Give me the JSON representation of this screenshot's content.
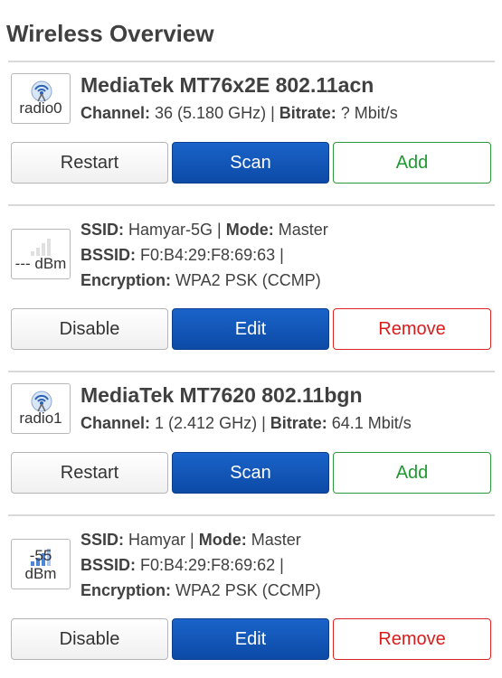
{
  "page": {
    "title": "Wireless Overview"
  },
  "devices": [
    {
      "radio_label": "radio0",
      "title": "MediaTek MT76x2E 802.11acn",
      "channel_label": "Channel:",
      "channel_value": " 36 (5.180 GHz) | ",
      "bitrate_label": "Bitrate:",
      "bitrate_value": " ? Mbit/s",
      "buttons": {
        "restart": "Restart",
        "scan": "Scan",
        "add": "Add"
      }
    },
    {
      "radio_label": "radio1",
      "title": "MediaTek MT7620 802.11bgn",
      "channel_label": "Channel:",
      "channel_value": " 1 (2.412 GHz) | ",
      "bitrate_label": "Bitrate:",
      "bitrate_value": " 64.1 Mbit/s",
      "buttons": {
        "restart": "Restart",
        "scan": "Scan",
        "add": "Add"
      }
    }
  ],
  "networks": [
    {
      "signal_label": "--- dBm",
      "ssid_label": "SSID:",
      "ssid_value": " Hamyar-5G | ",
      "mode_label": "Mode:",
      "mode_value": " Master",
      "bssid_label": "BSSID:",
      "bssid_value": " F0:B4:29:F8:69:63 |",
      "enc_label": "Encryption:",
      "enc_value": " WPA2 PSK (CCMP)",
      "signal_icon": "signal-bars-empty-icon",
      "buttons": {
        "disable": "Disable",
        "edit": "Edit",
        "remove": "Remove"
      }
    },
    {
      "signal_label": "-55 dBm",
      "ssid_label": "SSID:",
      "ssid_value": " Hamyar | ",
      "mode_label": "Mode:",
      "mode_value": " Master",
      "bssid_label": "BSSID:",
      "bssid_value": " F0:B4:29:F8:69:62 |",
      "enc_label": "Encryption:",
      "enc_value": " WPA2 PSK (CCMP)",
      "signal_icon": "signal-bars-good-icon",
      "buttons": {
        "disable": "Disable",
        "edit": "Edit",
        "remove": "Remove"
      }
    }
  ],
  "colors": {
    "primary": "#0c4aa6",
    "success": "#1f9a30",
    "danger": "#d91c1c",
    "divider": "#d9d9d9"
  }
}
